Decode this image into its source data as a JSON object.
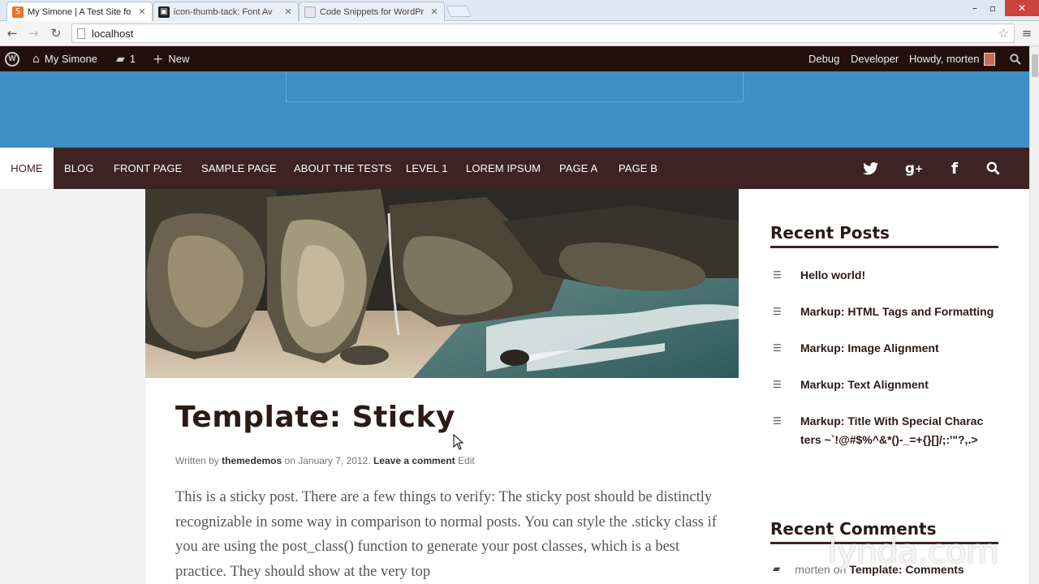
{
  "browser": {
    "tabs": [
      {
        "title": "My Simone | A Test Site fo",
        "favicon_color": "#e8742f",
        "active": true
      },
      {
        "title": "icon-thumb-tack: Font Av",
        "favicon_color": "#222222",
        "active": false
      },
      {
        "title": "Code Snippets for WordPr",
        "favicon_color": "#cfd6df",
        "active": false
      }
    ],
    "url": "localhost"
  },
  "adminbar": {
    "site_name": "My Simone",
    "comment_count": "1",
    "new_label": "New",
    "debug_label": "Debug",
    "developer_label": "Developer",
    "howdy_label": "Howdy, morten"
  },
  "nav": {
    "items": [
      "HOME",
      "BLOG",
      "FRONT PAGE",
      "SAMPLE PAGE",
      "ABOUT THE TESTS",
      "LEVEL 1",
      "LOREM IPSUM",
      "PAGE A",
      "PAGE B"
    ]
  },
  "post": {
    "title": "Template: Sticky",
    "meta_written_by": "Written by",
    "author": "themedemos",
    "meta_on": "on",
    "date": "January 7, 2012.",
    "leave_comment": "Leave a comment",
    "edit": "Edit",
    "body": "This is a sticky post. There are a few things to verify: The sticky post should be distinctly recognizable in some way in comparison to normal posts. You can style the .sticky class if you are using the post_class() function to generate your post classes, which is a best practice. They should show at the very top"
  },
  "sidebar": {
    "recent_posts_title": "Recent Posts",
    "recent_posts": [
      "Hello world!",
      "Markup: HTML Tags and Formatting",
      "Markup: Image Alignment",
      "Markup: Text Alignment",
      "Markup: Title With Special Characters ~`!@#$%^&*()-_=+{}[]/;:'\"?,.>"
    ],
    "recent_comments_title": "Recent Comments",
    "recent_comment_author": "morten",
    "recent_comment_on": "on",
    "recent_comment_post": "Template: Comments"
  },
  "watermark": "lynda.com",
  "colors": {
    "header_blue": "#3d8fc4",
    "nav_brown": "#3e2323",
    "adminbar": "#23100d"
  }
}
